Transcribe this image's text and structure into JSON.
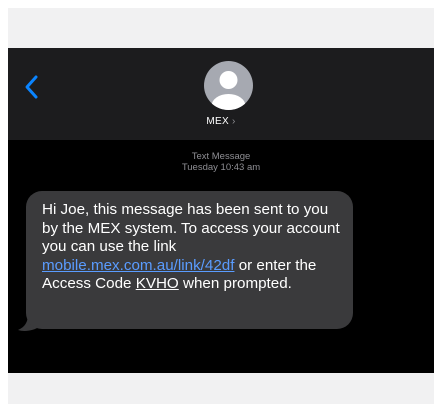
{
  "contact": {
    "name": "MEX",
    "chevron": "›"
  },
  "icons": {
    "back": "chevron-left-icon",
    "avatar": "person-silhouette-icon"
  },
  "colors": {
    "screen_background": "#000000",
    "header_background": "#1c1c1e",
    "bubble_background": "#3a3a3c",
    "accent_blue": "#0a84ff",
    "link_blue": "#5a9cff",
    "meta_gray": "#8e8e93",
    "avatar_gray": "#a6a9b1"
  },
  "thread": {
    "channel_label": "Text Message",
    "timestamp": "Tuesday 10:43 am"
  },
  "message": {
    "text_before_link": "Hi Joe, this message has been sent to you by the MEX system. To access your account you can use the link ",
    "link": "mobile.mex.com.au/link/42df",
    "text_after_link": " or enter the Access Code ",
    "access_code": "KVHO",
    "text_end": " when prompted."
  }
}
